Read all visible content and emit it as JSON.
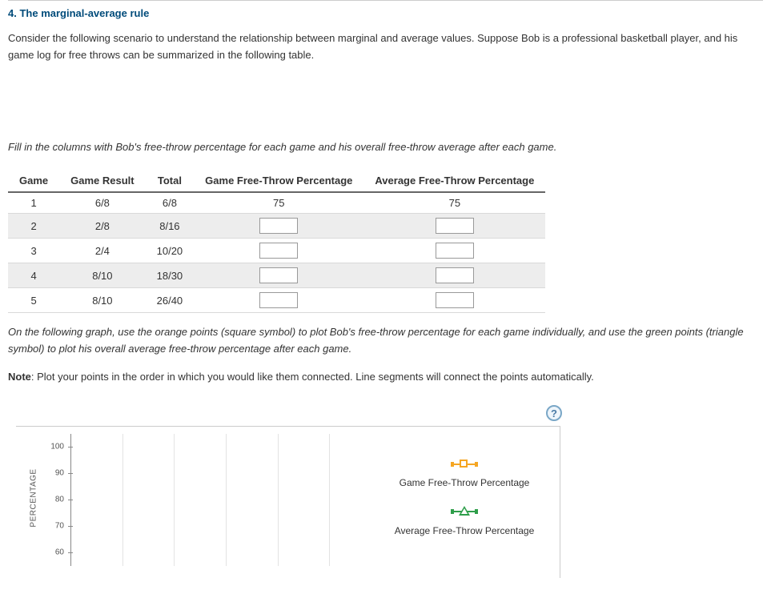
{
  "section": {
    "number": "4.",
    "title": "The marginal-average rule"
  },
  "intro": "Consider the following scenario to understand the relationship between marginal and average values. Suppose Bob is a professional basketball player, and his game log for free throws can be summarized in the following table.",
  "instruction": "Fill in the columns with Bob's free-throw percentage for each game and his overall free-throw average after each game.",
  "table": {
    "headers": {
      "game": "Game",
      "result": "Game Result",
      "total": "Total",
      "game_pct": "Game Free-Throw Percentage",
      "avg_pct": "Average Free-Throw Percentage"
    },
    "rows": [
      {
        "game": "1",
        "result": "6/8",
        "total": "6/8",
        "game_pct": "75",
        "avg_pct": "75",
        "editable": false
      },
      {
        "game": "2",
        "result": "2/8",
        "total": "8/16",
        "game_pct": "",
        "avg_pct": "",
        "editable": true
      },
      {
        "game": "3",
        "result": "2/4",
        "total": "10/20",
        "game_pct": "",
        "avg_pct": "",
        "editable": true
      },
      {
        "game": "4",
        "result": "8/10",
        "total": "18/30",
        "game_pct": "",
        "avg_pct": "",
        "editable": true
      },
      {
        "game": "5",
        "result": "8/10",
        "total": "26/40",
        "game_pct": "",
        "avg_pct": "",
        "editable": true
      }
    ]
  },
  "graph_instruction": "On the following graph, use the orange points (square symbol) to plot Bob's free-throw percentage for each game individually, and use the green points (triangle symbol) to plot his overall average free-throw percentage after each game.",
  "note_label": "Note",
  "note_text": ": Plot your points in the order in which you would like them connected. Line segments will connect the points automatically.",
  "help_symbol": "?",
  "legend": {
    "series1": "Game Free-Throw Percentage",
    "series2": "Average Free-Throw Percentage"
  },
  "chart_data": {
    "type": "line",
    "ylabel": "PERCENTAGE",
    "y_ticks": [
      60,
      70,
      80,
      90,
      100
    ],
    "ylim": [
      55,
      105
    ],
    "x_gridlines": 5,
    "series": [
      {
        "name": "Game Free-Throw Percentage",
        "symbol": "square",
        "color": "#f5a623",
        "values": []
      },
      {
        "name": "Average Free-Throw Percentage",
        "symbol": "triangle",
        "color": "#2e9e4a",
        "values": []
      }
    ]
  }
}
